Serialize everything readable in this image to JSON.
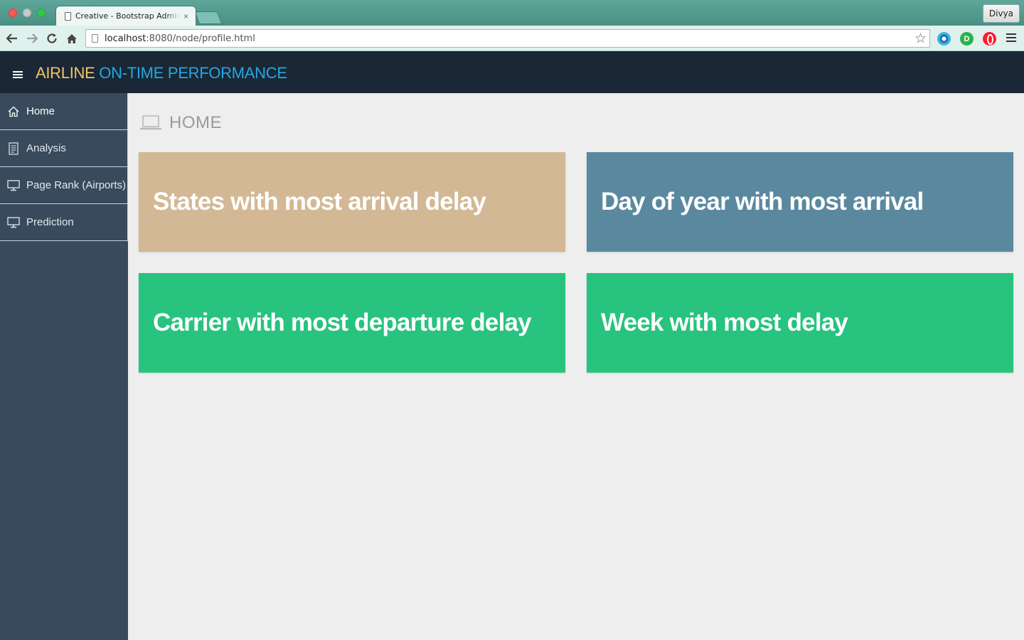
{
  "browser": {
    "tab_title": "Creative - Bootstrap Admin",
    "tab_close": "×",
    "profile_name": "Divya",
    "url_host": "localhost",
    "url_path": ":8080/node/profile.html"
  },
  "header": {
    "brand_part1": "AIRLINE",
    "brand_part2": "ON-TIME PERFORMANCE",
    "brand_part1_color": "#f0c46a",
    "brand_part2_color": "#22a8e6"
  },
  "sidebar": {
    "items": [
      {
        "label": "Home",
        "icon": "home-icon",
        "active": true
      },
      {
        "label": "Analysis",
        "icon": "document-icon",
        "active": false
      },
      {
        "label": "Page Rank (Airports)",
        "icon": "monitor-icon",
        "active": false
      },
      {
        "label": "Prediction",
        "icon": "monitor-icon",
        "active": false
      }
    ]
  },
  "main": {
    "page_title": "HOME",
    "page_icon": "laptop-icon",
    "cards": [
      {
        "title": "States with most arrival delay",
        "color": "#d2b894"
      },
      {
        "title": "Day of year with most arrival",
        "color": "#5a889e"
      },
      {
        "title": "Carrier with most departure delay",
        "color": "#27c37f"
      },
      {
        "title": "Week with most delay",
        "color": "#27c37f"
      }
    ]
  }
}
